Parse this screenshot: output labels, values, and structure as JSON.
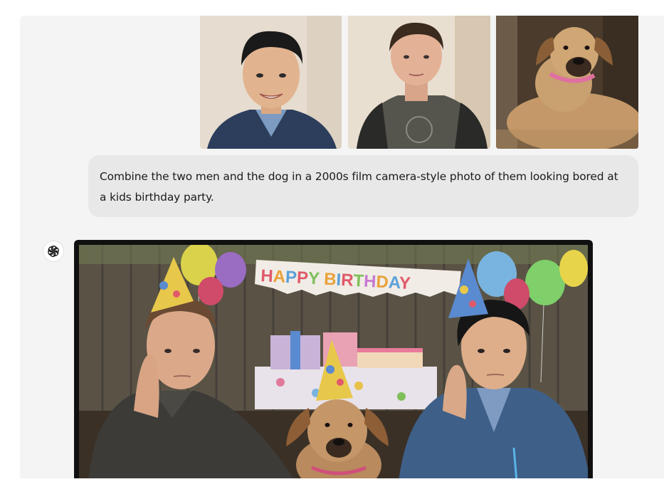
{
  "conversation": {
    "user_images": [
      {
        "icon": "photo-man-smiling"
      },
      {
        "icon": "photo-man-grey-shirt"
      },
      {
        "icon": "photo-dog"
      }
    ],
    "user_message": "Combine the two men and the dog in a 2000s film camera-style photo of them looking bored at a kids birthday party.",
    "assistant": {
      "avatar_icon": "openai-logo-icon",
      "image_icon": "generated-birthday-photo",
      "banner_letters": [
        "H",
        "A",
        "P",
        "P",
        "Y",
        " ",
        "B",
        "I",
        "R",
        "T",
        "H",
        "D",
        "A",
        "Y"
      ],
      "banner_colors": [
        "#e05a6a",
        "#e8a23a",
        "#5aa0d8",
        "#7fbf5a",
        "#c77ad0"
      ]
    }
  }
}
